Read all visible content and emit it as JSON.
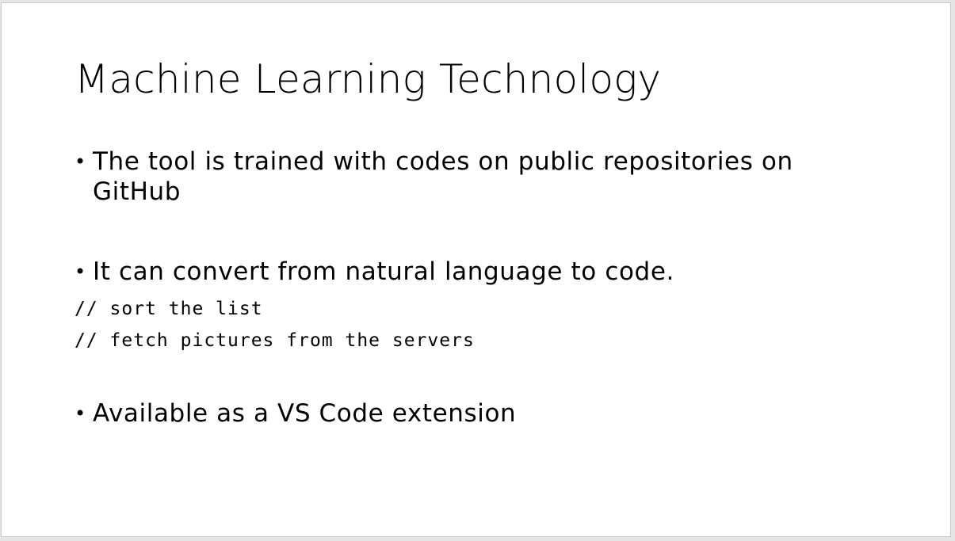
{
  "slide": {
    "title": "Machine Learning Technology",
    "bullets": [
      {
        "glyph": "•",
        "text": "The tool is trained with codes on public repositories on GitHub"
      },
      {
        "glyph": "•",
        "text": "It can convert from natural language to code."
      },
      {
        "glyph": "•",
        "text": "Available as a VS Code extension"
      }
    ],
    "code_lines": [
      "// sort the list",
      "// fetch pictures from the servers"
    ]
  }
}
